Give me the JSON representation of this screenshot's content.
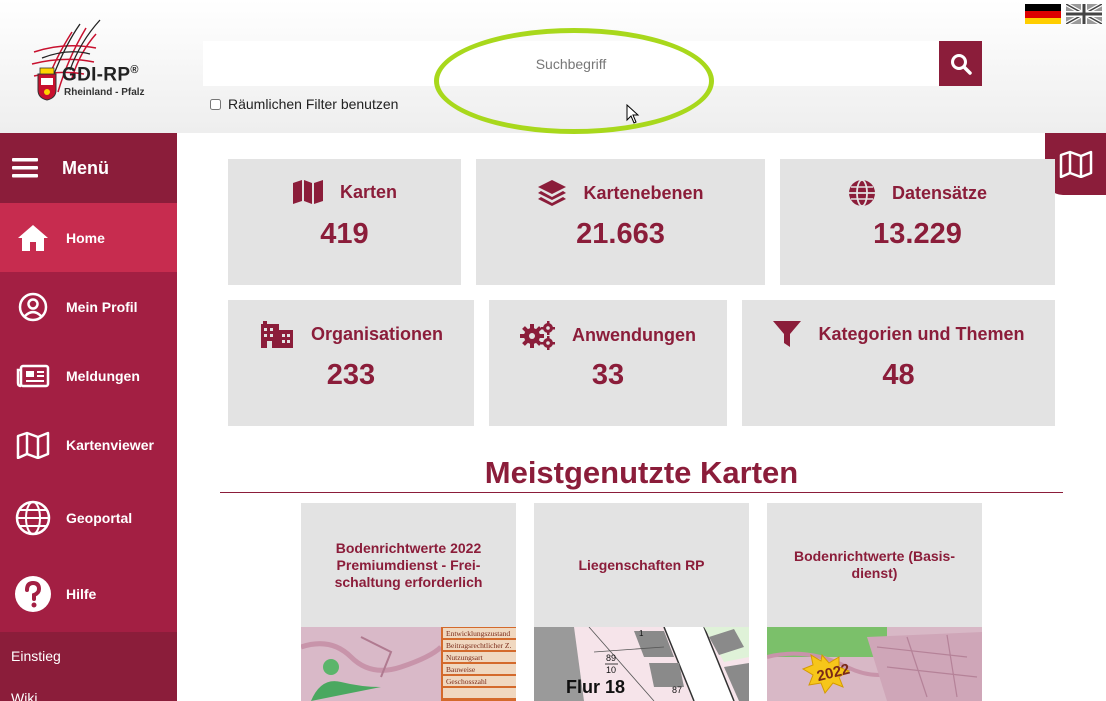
{
  "header": {
    "logo_title": "GDI-RP",
    "logo_reg": "®",
    "logo_subtitle": "Rheinland - Pfalz",
    "search_placeholder": "Suchbegriff",
    "filter_label": "Räumlichen Filter benutzen"
  },
  "sidebar": {
    "menu_label": "Menü",
    "items": [
      {
        "label": "Home",
        "icon": "home-icon",
        "active": true
      },
      {
        "label": "Mein Profil",
        "icon": "user-circle-icon"
      },
      {
        "label": "Meldungen",
        "icon": "newspaper-icon"
      },
      {
        "label": "Kartenviewer",
        "icon": "map-icon"
      },
      {
        "label": "Geoportal",
        "icon": "globe-icon"
      },
      {
        "label": "Hilfe",
        "icon": "question-icon"
      }
    ],
    "sub_links": [
      "Einstieg",
      "Wiki"
    ]
  },
  "stats": [
    {
      "label": "Karten",
      "value": "419",
      "icon": "map-icon"
    },
    {
      "label": "Kartenebenen",
      "value": "21.663",
      "icon": "layers-icon"
    },
    {
      "label": "Datensätze",
      "value": "13.229",
      "icon": "globe-icon"
    },
    {
      "label": "Organisationen",
      "value": "233",
      "icon": "building-icon"
    },
    {
      "label": "Anwendungen",
      "value": "33",
      "icon": "gears-icon"
    },
    {
      "label": "Kategorien und Themen",
      "value": "48",
      "icon": "filter-icon"
    }
  ],
  "section": {
    "title": "Meistgenutzte Karten"
  },
  "maps": [
    {
      "title": "Bodenrichtwerte 2022 Premiumdienst - Frei-schaltung erforderlich"
    },
    {
      "title": "Liegenschaften RP",
      "thumb_text": "Flur 18"
    },
    {
      "title": "Bodenrichtwerte (Basis-dienst)",
      "thumb_text": "2022"
    }
  ],
  "thumb_legend": [
    "Entwicklungszustand",
    "Beitragsrechtlicher Z.",
    "Nutzungsart",
    "Bauweise",
    "Geschosszahl"
  ],
  "thumb_numbers": [
    "89",
    "10",
    "87",
    "1"
  ],
  "colors": {
    "brand": "#8b1d3a",
    "sidebar": "#a31f43",
    "active": "#c72c4f",
    "card_bg": "#e3e3e3",
    "highlight": "#a8d81c"
  }
}
